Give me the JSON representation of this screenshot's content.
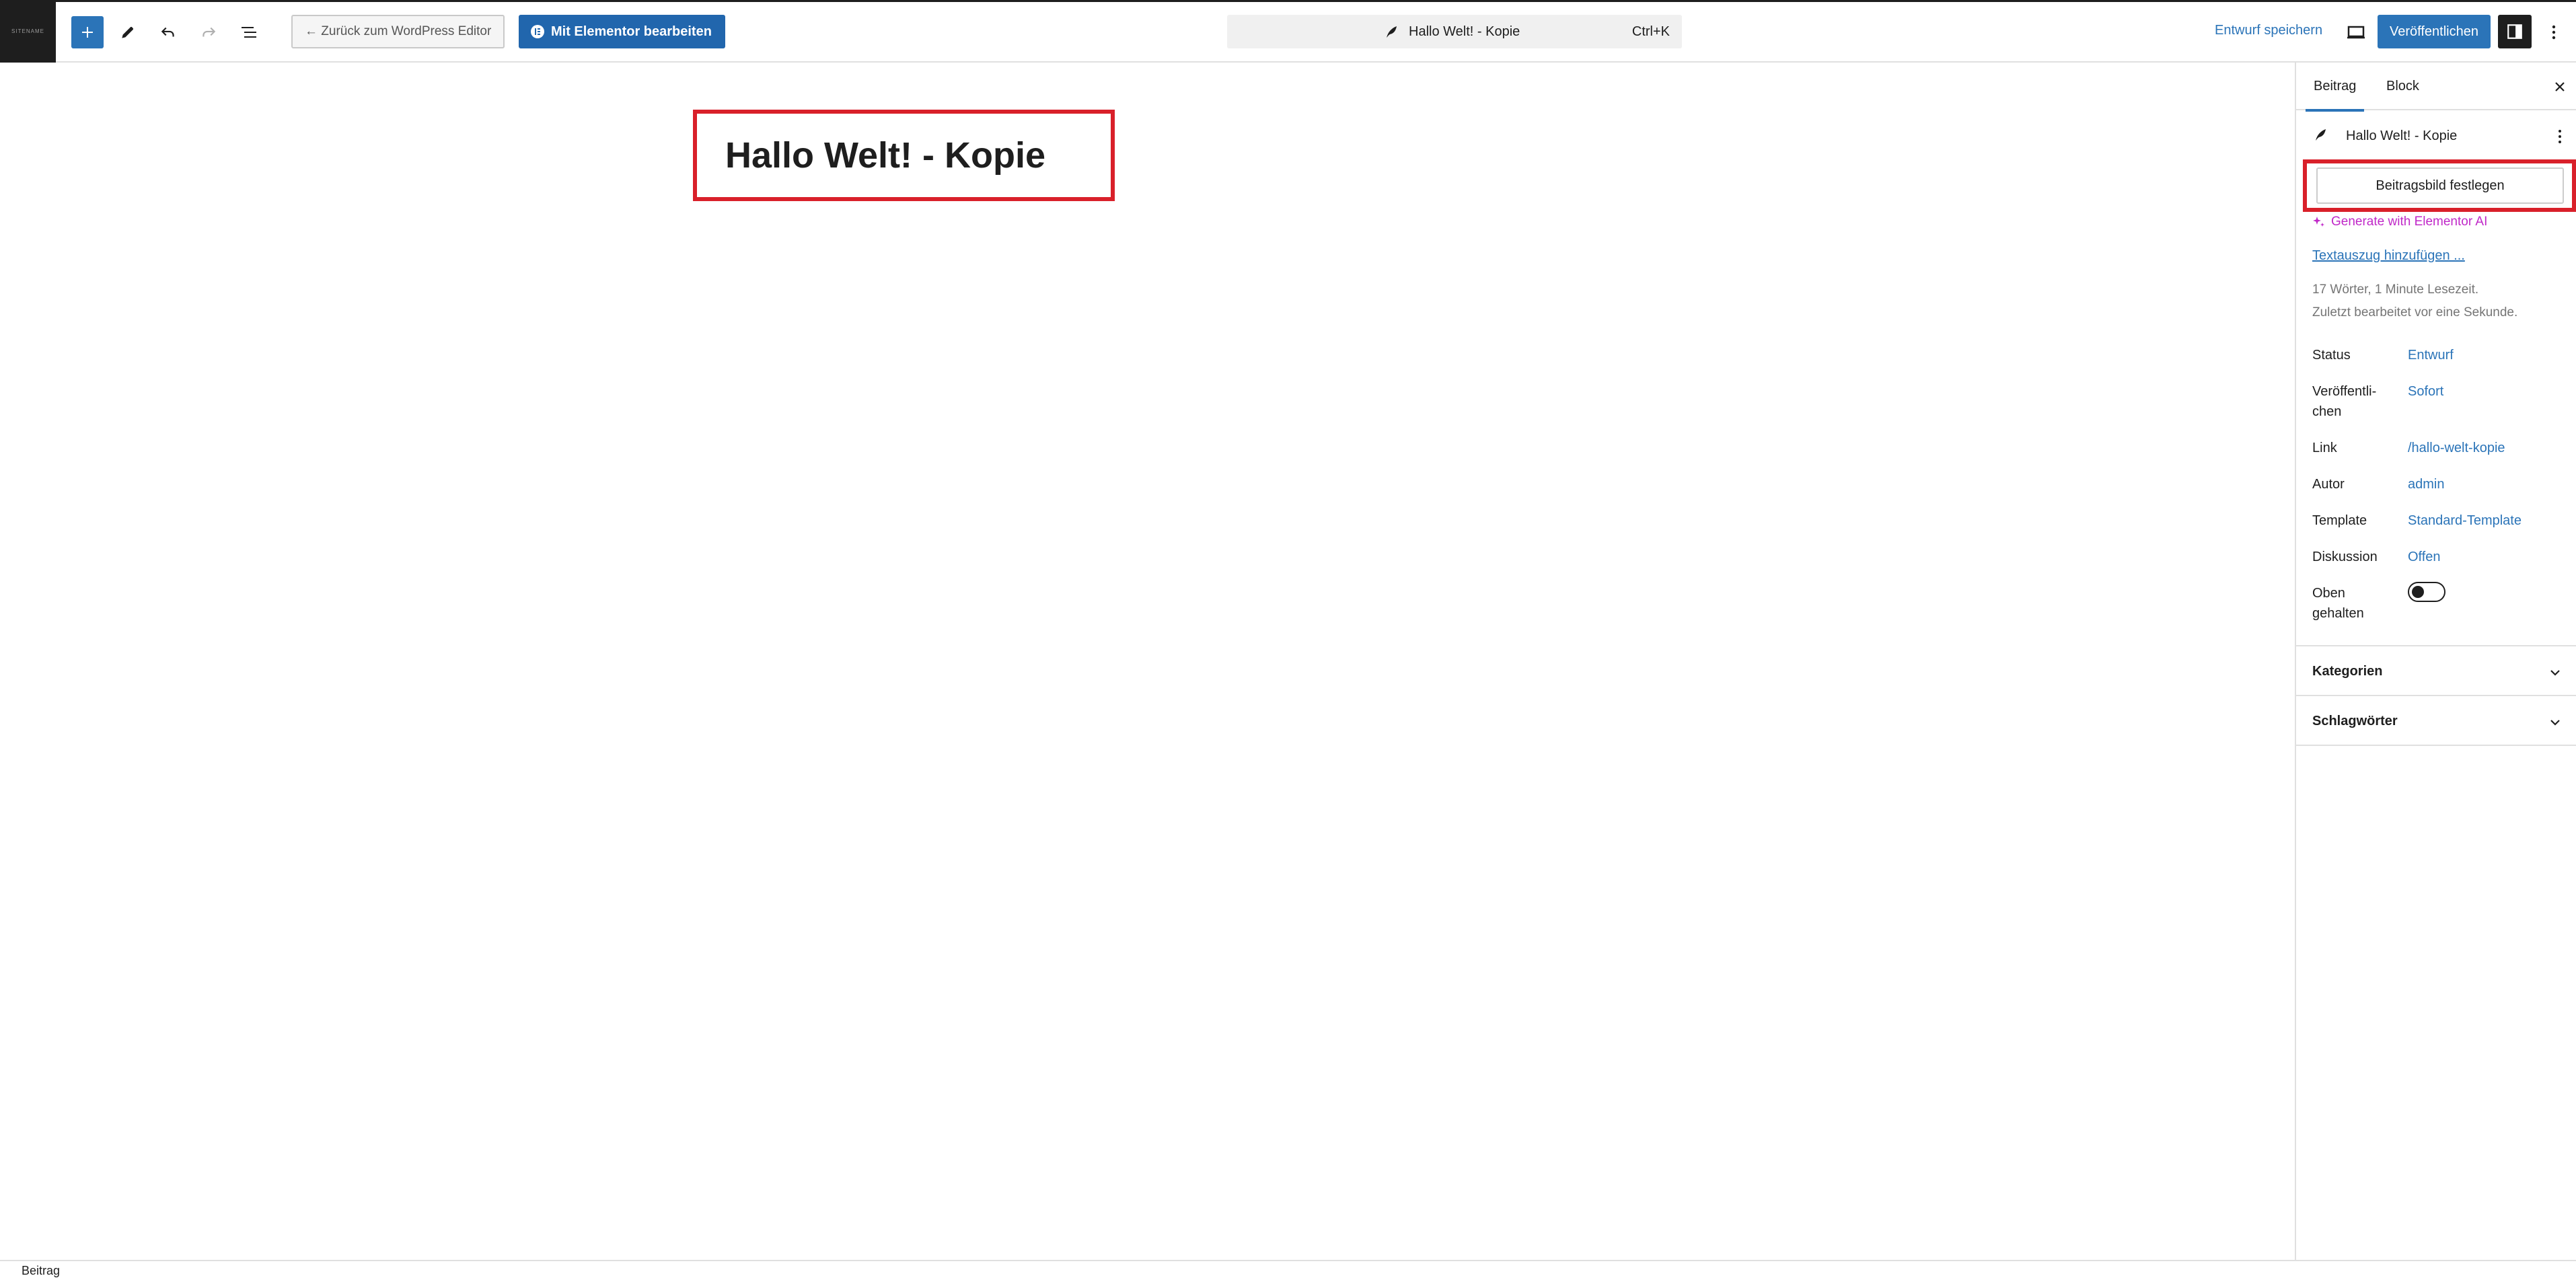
{
  "topbar": {
    "logo_text": "SITENAME",
    "back_label": "← Zurück zum WordPress Editor",
    "elementor_label": "Mit Elementor bearbeiten",
    "command_title": "Hallo Welt! - Kopie",
    "command_shortcut": "Ctrl+K",
    "save_draft_label": "Entwurf speichern",
    "publish_label": "Veröffentlichen"
  },
  "editor": {
    "post_title": "Hallo Welt! - Kopie"
  },
  "sidebar": {
    "tabs": [
      "Beitrag",
      "Block"
    ],
    "post_title": "Hallo Welt! - Kopie",
    "featured_image_label": "Beitragsbild festlegen",
    "ai_label": "Generate with Elementor AI",
    "excerpt_label": "Textauszug hinzufügen ...",
    "word_count": "17 Wörter, 1 Minute Lesezeit.",
    "last_edited": "Zuletzt bearbeitet vor eine Sekunde.",
    "rows": [
      {
        "label": "Status",
        "value": "Entwurf"
      },
      {
        "label": "Veröffentli-",
        "label2": "chen",
        "value": "Sofort"
      },
      {
        "label": "Link",
        "value": "/hallo-welt-kopie"
      },
      {
        "label": "Autor",
        "value": "admin"
      },
      {
        "label": "Template",
        "value": "Standard-Template"
      },
      {
        "label": "Diskussion",
        "value": "Offen"
      }
    ],
    "sticky_label": "Oben",
    "sticky_label2": "gehalten",
    "sticky_on": false,
    "panels": [
      "Kategorien",
      "Schlagwörter"
    ]
  },
  "footer": {
    "breadcrumb": "Beitrag"
  },
  "colors": {
    "accent": "#2b74b8",
    "highlight_border": "#d9202a",
    "ai": "#c028c8"
  }
}
